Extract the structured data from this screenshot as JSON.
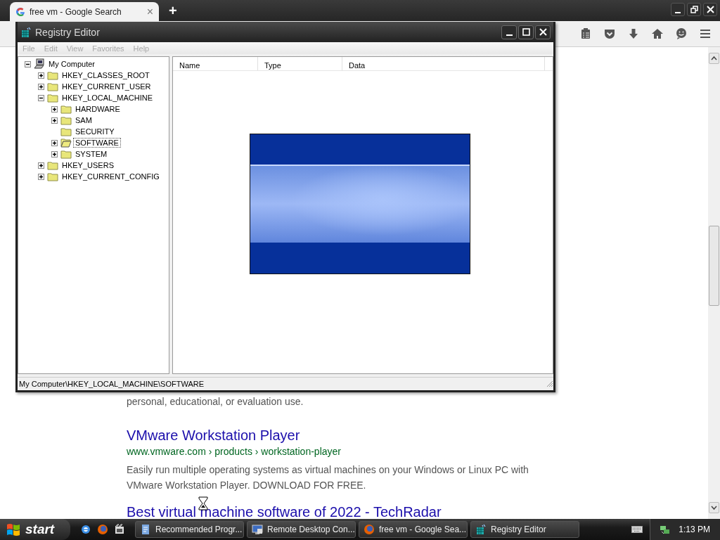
{
  "browser": {
    "tab": {
      "title": "free vm - Google Search",
      "close": "×",
      "selected": true
    },
    "new_tab": "+"
  },
  "registry_editor": {
    "title": "Registry Editor",
    "menu": [
      {
        "label": "File",
        "disabled": true
      },
      {
        "label": "Edit",
        "disabled": true
      },
      {
        "label": "View",
        "disabled": true
      },
      {
        "label": "Favorites",
        "disabled": true
      },
      {
        "label": "Help",
        "disabled": true
      }
    ],
    "tree": {
      "label": "My Computer",
      "kind": "computer",
      "has_children": true,
      "expanded": true,
      "selected": false,
      "children": [
        {
          "label": "HKEY_CLASSES_ROOT",
          "kind": "folder",
          "has_children": true,
          "expanded": false,
          "selected": false
        },
        {
          "label": "HKEY_CURRENT_USER",
          "kind": "folder",
          "has_children": true,
          "expanded": false,
          "selected": false
        },
        {
          "label": "HKEY_LOCAL_MACHINE",
          "kind": "folder",
          "has_children": true,
          "expanded": true,
          "selected": false,
          "children": [
            {
              "label": "HARDWARE",
              "kind": "folder",
              "has_children": true,
              "expanded": false,
              "selected": false
            },
            {
              "label": "SAM",
              "kind": "folder",
              "has_children": true,
              "expanded": false,
              "selected": false
            },
            {
              "label": "SECURITY",
              "kind": "folder",
              "has_children": false,
              "expanded": false,
              "selected": false
            },
            {
              "label": "SOFTWARE",
              "kind": "folder",
              "has_children": true,
              "expanded": false,
              "selected": true
            },
            {
              "label": "SYSTEM",
              "kind": "folder",
              "has_children": true,
              "expanded": false,
              "selected": false
            }
          ]
        },
        {
          "label": "HKEY_USERS",
          "kind": "folder",
          "has_children": true,
          "expanded": false,
          "selected": false
        },
        {
          "label": "HKEY_CURRENT_CONFIG",
          "kind": "folder",
          "has_children": true,
          "expanded": false,
          "selected": false
        }
      ]
    },
    "columns": [
      "Name",
      "Type",
      "Data"
    ],
    "status_bar": "My Computer\\HKEY_LOCAL_MACHINE\\SOFTWARE"
  },
  "results": [
    {
      "kind": "snippet",
      "text": "personal, educational, or evaluation use."
    },
    {
      "kind": "result",
      "title": "VMware Workstation Player",
      "url": "www.vmware.com › products › workstation-player",
      "snippet": "Easily run multiple operating systems as virtual machines on your Windows or Linux PC with VMware Workstation Player. DOWNLOAD FOR FREE."
    },
    {
      "kind": "title",
      "title": "Best virtual machine software of 2022 - TechRadar"
    }
  ],
  "taskbar": {
    "start": "start",
    "tasks": [
      {
        "label": "Recommended Progr...",
        "kind": "document"
      },
      {
        "label": "Remote Desktop Con...",
        "kind": "remote"
      },
      {
        "label": "free vm - Google Sea...",
        "kind": "firefox"
      },
      {
        "label": "Registry Editor",
        "kind": "registry"
      }
    ],
    "clock": "1:13 PM"
  }
}
